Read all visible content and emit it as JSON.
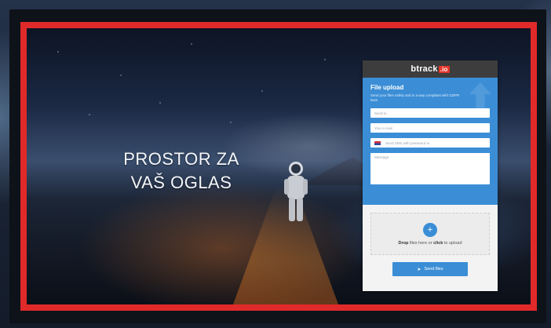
{
  "advert": {
    "headline_line1": "PROSTOR ZA",
    "headline_line2": "VAŠ OGLAS",
    "frame_color": "#e02a2a"
  },
  "widget": {
    "logo_text": "btrack",
    "logo_badge": ".io",
    "title": "File upload",
    "description": "Send your files safely and in a way compliant with GDPR laws",
    "fields": {
      "email_placeholder": "Send to",
      "your_email_placeholder": "Your e-mail",
      "phone_placeholder": "Send SMS with password to",
      "message_placeholder": "Message"
    },
    "drop_icon": "+",
    "drop_strong1": "Drop",
    "drop_text1": " files here or ",
    "drop_strong2": "click",
    "drop_text2": " to upload",
    "send_icon": "paper-plane-icon",
    "send_label": "Send files",
    "accent_color": "#3b8ed6"
  }
}
